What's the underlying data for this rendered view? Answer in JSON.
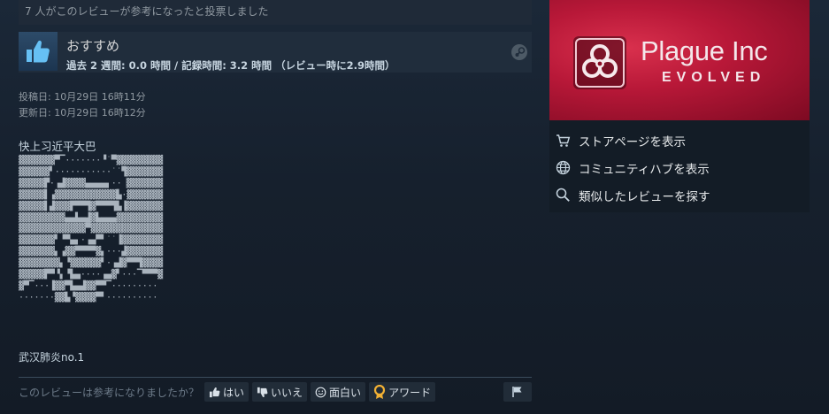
{
  "header": {
    "helpful_count_text": "7 人がこのレビューが参考になったと投票しました"
  },
  "review": {
    "verdict": "おすすめ",
    "hours": "過去 2 週間: 0.0 時間 / 記録時間: 3.2 時間 （レビュー時に2.9時間）",
    "posted": "投稿日: 10月29日 16時11分",
    "updated": "更新日: 10月29日 16時12分",
    "text_top": "快上习近平大巴",
    "ascii_art": [
      "▓▓▓▓▓▓▓▀▔·······▝˙▀▓▓▓▓▓▓▓▓▓",
      "▓▓▓▓▓▓▘···········˙˙▜▓▓▓▓▓▓▓",
      "▓▓▓▓▓▛·▗▟▓▓▓▓▄▄▄▄▖··▕▓▓▓▓▓▓▓",
      "▓▓▓▓▓▌▗▓▓▓▓▓▓▓▓▓▓▓▓▙·▓▓▓▓▓▓▓",
      "▓▓▓▓▓▌▟▓▓▓▛▀▀▜▓▀▀▀▜▙▐▓▓▓▓▓▓▓",
      "▓▓▓▓▓▓▓▓▓▄▄▙▄▟▓▙▄▄▄▓▓▓▓▓▓▓▓▓",
      "▓▓▓▓▓▓▓▓▓▓▓▓▓▀▓▓▓▓▓▓▓▓▓▓▓▓▓▓",
      "▓▓▓▓▓▓▓▘▝▀▄▖·▗▄▀▘˙˙▐▓▓▓▓▓▓▓▓",
      "▓▓▓▓▓▓▓▖▗▓▓▀▀▀▀▓▖···▟▓▓▓▓▓▓▓",
      "▓▓▓▓▓▓▓▓▖▝▓▓▓▓▓▓▘·▗▟▓▀▀▜▓▓▓▓",
      "▓▓▓▓▓▛▀▝▖▝▙▄····▗▄▓▘···▔▀▀▀▓",
      "▓▀▔···▐▓▓▀▙▄▟▓▓▀▀▔·········",
      "·······▓▓▙▝▓▓▓▓▀▘··········"
    ],
    "text_bottom": "武汉肺炎no.1"
  },
  "vote": {
    "question": "このレビューは参考になりましたか？",
    "yes_label": "はい",
    "no_label": "いいえ",
    "funny_label": "面白い",
    "award_label": "アワード"
  },
  "game": {
    "title": "Plague Inc",
    "subtitle": "EVOLVED",
    "links": [
      {
        "label": "ストアページを表示",
        "icon": "cart-icon"
      },
      {
        "label": "コミュニティハブを表示",
        "icon": "globe-icon"
      },
      {
        "label": "類似したレビューを探す",
        "icon": "search-icon"
      }
    ]
  },
  "colors": {
    "accent": "#66c0f4",
    "banner_red": "#c21e3e",
    "background": "#1b2838"
  }
}
